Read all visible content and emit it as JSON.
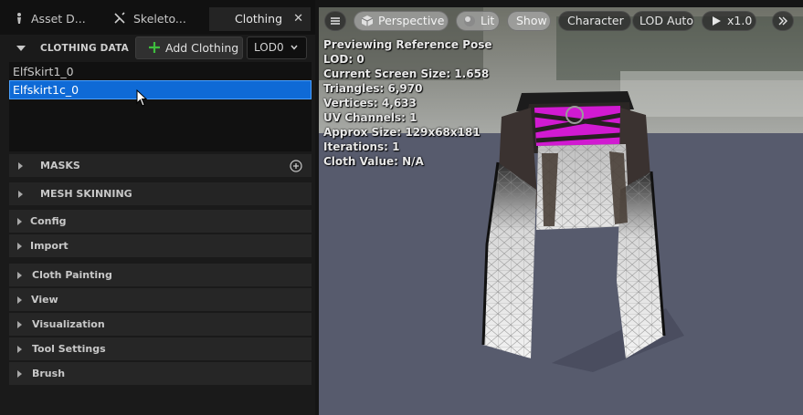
{
  "tabs": [
    {
      "label": "Asset D...",
      "icon": "asset-icon"
    },
    {
      "label": "Skeleto...",
      "icon": "skeleton-icon"
    },
    {
      "label": "Clothing",
      "icon": "",
      "active": true,
      "close": "✕"
    }
  ],
  "clothing_data": {
    "title": "CLOTHING DATA",
    "add_button": "Add Clothing",
    "lod_value": "LOD0",
    "items": [
      {
        "label": "ElfSkirt1_0",
        "selected": false
      },
      {
        "label": "Elfskirt1c_0",
        "selected": true
      }
    ]
  },
  "sections": [
    {
      "label": "MASKS",
      "has_add": true
    },
    {
      "label": "MESH SKINNING",
      "has_add": false
    },
    {
      "label": "Config"
    },
    {
      "label": "Import"
    },
    {
      "label": "Cloth Painting"
    },
    {
      "label": "View"
    },
    {
      "label": "Visualization"
    },
    {
      "label": "Tool Settings"
    },
    {
      "label": "Brush"
    }
  ],
  "viewport": {
    "buttons": {
      "perspective": "Perspective",
      "lit": "Lit",
      "show": "Show",
      "character": "Character",
      "lod": "LOD Auto",
      "speed": "x1.0"
    },
    "stats": [
      "Previewing Reference Pose",
      "LOD: 0",
      "Current Screen Size: 1.658",
      "Triangles: 6,970",
      "Vertices: 4,633",
      "UV Channels: 1",
      "Approx Size: 129x68x181",
      "Iterations: 1",
      "Cloth Value: N/A"
    ]
  },
  "colors": {
    "selection": "#0f6ad6",
    "add_plus": "#3ebd3e",
    "magenta_mask": "#d11ad1"
  }
}
